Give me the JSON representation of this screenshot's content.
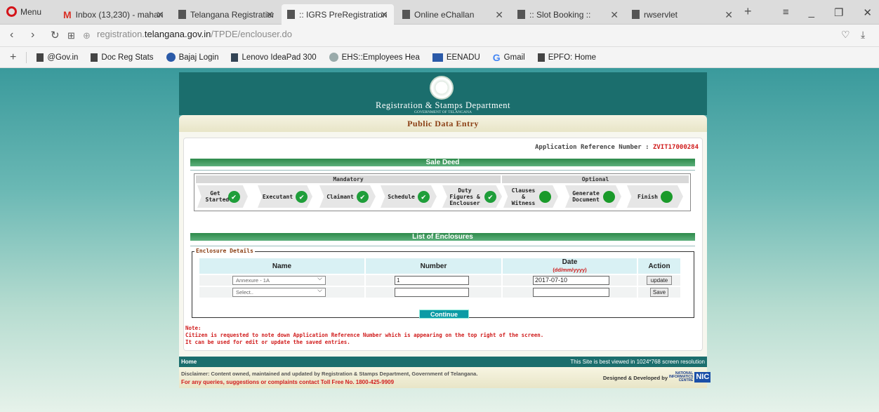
{
  "browser": {
    "menu_label": "Menu",
    "tabs": [
      {
        "label": "Inbox (13,230) - mahan",
        "icon": "gmail-icon"
      },
      {
        "label": "Telangana Registration",
        "icon": "page-icon"
      },
      {
        "label": ":: IGRS PreRegistration ::",
        "icon": "page-icon"
      },
      {
        "label": "Online eChallan",
        "icon": "page-icon"
      },
      {
        "label": ":: Slot Booking ::",
        "icon": "page-icon"
      },
      {
        "label": "rwservlet",
        "icon": "page-icon"
      }
    ],
    "url_prefix": "registration.",
    "url_domain": "telangana.gov.in",
    "url_path": "/TPDE/enclouser.do",
    "bookmarks": [
      "@Gov.in",
      "Doc Reg Stats",
      "Bajaj Login",
      "Lenovo IdeaPad 300",
      "EHS::Employees Hea",
      "EENADU",
      "Gmail",
      "EPFO: Home"
    ]
  },
  "site": {
    "department": "Registration & Stamps Department",
    "government": "GOVERNMENT OF TELANGANA",
    "section_title": "Public Data Entry",
    "app_ref_label": "Application Reference Number  : ",
    "app_ref_number": "ZVIT17000284",
    "deed_title": "Sale Deed",
    "mandatory_label": "Mandatory",
    "optional_label": "Optional",
    "steps": [
      {
        "label": "Get Started",
        "status": "done"
      },
      {
        "label": "Executant",
        "status": "done"
      },
      {
        "label": "Claimant",
        "status": "done"
      },
      {
        "label": "Schedule",
        "status": "done"
      },
      {
        "label": "Duty Figures & Enclouser",
        "status": "done"
      },
      {
        "label": "Clauses & Witness",
        "status": "pending"
      },
      {
        "label": "Generate Document",
        "status": "pending"
      },
      {
        "label": "Finish",
        "status": "pending"
      }
    ],
    "enclosures_title": "List of Enclosures",
    "enclosure_legend": "Enclosure Details",
    "table": {
      "headers": {
        "name": "Name",
        "number": "Number",
        "date": "Date",
        "date_format": "(dd/mm/yyyy)",
        "action": "Action"
      },
      "rows": [
        {
          "name": "Annexure - 1A",
          "number": "1",
          "date": "2017-07-10",
          "action": "update"
        },
        {
          "name": "Select..",
          "number": "",
          "date": "",
          "action": "Save"
        }
      ]
    },
    "continue_label": "Continue",
    "note_title": "Note:",
    "note_line1": "Citizen is requested to note down Application Reference Number which is appearing on the top right of the screen.",
    "note_line2": "It can be used for edit or update the saved entries.",
    "footer_home": "Home",
    "footer_best_view": "This Site is best viewed in 1024*768 screen resolution",
    "disclaimer": "Disclaimer: Content owned, maintained and updated by Registration & Stamps Department, Government of Telangana.",
    "toll_free": "For any queries, suggestions or complaints contact Toll Free No. 1800-425-9909",
    "developed_by": "Designed & Developed by",
    "nic_text": "NATIONAL INFORMATICS CENTRE",
    "nic_logo": "NIC"
  }
}
